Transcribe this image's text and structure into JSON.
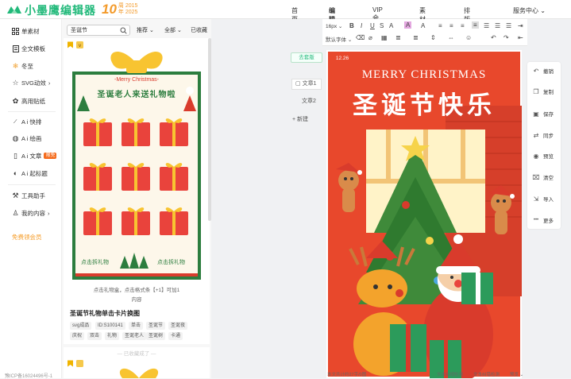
{
  "brand": {
    "name": "小墨鹰编辑器",
    "anniversary_number": "10",
    "anniversary_from": "周 2015",
    "anniversary_to": "年 2025",
    "color": "#21b97a",
    "accent": "#f39a2a"
  },
  "topnav": [
    {
      "label": "首页"
    },
    {
      "label": "编辑器",
      "active": true
    },
    {
      "label": "VIP会员"
    },
    {
      "label": "素材库"
    },
    {
      "label": "排版课堂"
    },
    {
      "label": "服务中心",
      "dropdown": true
    }
  ],
  "leftnav": {
    "items": [
      {
        "label": "单素材",
        "icon": "grid-icon"
      },
      {
        "label": "全文模板",
        "icon": "document-icon"
      },
      {
        "label": "冬至",
        "icon": "snowflake-icon"
      },
      {
        "label": "SVG动效",
        "icon": "star-icon",
        "arrow": "›"
      },
      {
        "label": "高用贴纸",
        "icon": "sticker-icon"
      },
      {
        "label": "A i 快排",
        "icon": "ai-layout-icon"
      },
      {
        "label": "A i 绘画",
        "icon": "palette-icon"
      },
      {
        "label": "A i 文章",
        "icon": "ai-doc-icon",
        "badge": "限免"
      },
      {
        "label": "A i 起标题",
        "icon": "ai-title-icon"
      },
      {
        "label": "工具助手",
        "icon": "toolbox-icon"
      },
      {
        "label": "我的内容",
        "icon": "user-icon",
        "arrow": "›"
      }
    ],
    "vip_link": "免费领会员",
    "icp": "豫ICP备16024496号-1"
  },
  "materials": {
    "search_value": "圣诞节",
    "filters": [
      "推荐",
      "全部",
      "已收藏"
    ],
    "card": {
      "poster_subtitle": "-Merry Christmas-",
      "poster_title": "圣诞老人来送礼物啦",
      "poster_footer": "点击拆礼物",
      "instruction": "点击礼物盒，点击格式条【+1】可加1",
      "instruction_2": "内容",
      "title": "圣诞节礼物单击卡片换图",
      "tags": [
        "svg成品",
        "ID:S100141",
        "单击",
        "圣诞节",
        "圣诞夜",
        "庆祝",
        "双击",
        "礼物",
        "圣诞老人",
        "圣诞树",
        "卡通"
      ]
    },
    "collected_label": "— 已收藏成了 —"
  },
  "toolbar": {
    "font_size": "16px",
    "row1": [
      "B",
      "I",
      "U",
      "A",
      "A",
      "A",
      "≡",
      "≡",
      "≡",
      "≡",
      "☰",
      "☰",
      "☰",
      "⇥"
    ],
    "font_family": "默认字体",
    "row2": [
      "⌫",
      "⌀",
      "▦",
      "≣",
      "≣",
      "⇕",
      "⇔",
      "☺",
      "↶",
      "↷",
      "⇤"
    ]
  },
  "pages": {
    "copy_label": "去套版",
    "items": [
      "文章1",
      "文章2"
    ],
    "new_label": "新建"
  },
  "poster": {
    "date": "12.26",
    "headline_en": "MERRY CHRISTMAS",
    "headline_cn": "圣诞节快乐"
  },
  "right_tools": [
    {
      "label": "撤销",
      "icon": "undo-icon",
      "glyph": "↶"
    },
    {
      "label": "复制",
      "icon": "copy-icon",
      "glyph": "❐"
    },
    {
      "label": "保存",
      "icon": "save-icon",
      "glyph": "▣"
    },
    {
      "label": "同步",
      "icon": "sync-icon",
      "glyph": "⇄"
    },
    {
      "label": "预览",
      "icon": "eye-icon",
      "glyph": "◉"
    },
    {
      "label": "清空",
      "icon": "trash-icon",
      "glyph": "⌧"
    },
    {
      "label": "导入",
      "icon": "import-icon",
      "glyph": "⇲"
    },
    {
      "label": "更多",
      "icon": "more-icon",
      "glyph": "•••"
    }
  ],
  "status": {
    "word_count": "本文共计约27字/0图",
    "ai_check": "文本合规检测",
    "typo_check": "文本纠错检测",
    "mode": "预览"
  }
}
